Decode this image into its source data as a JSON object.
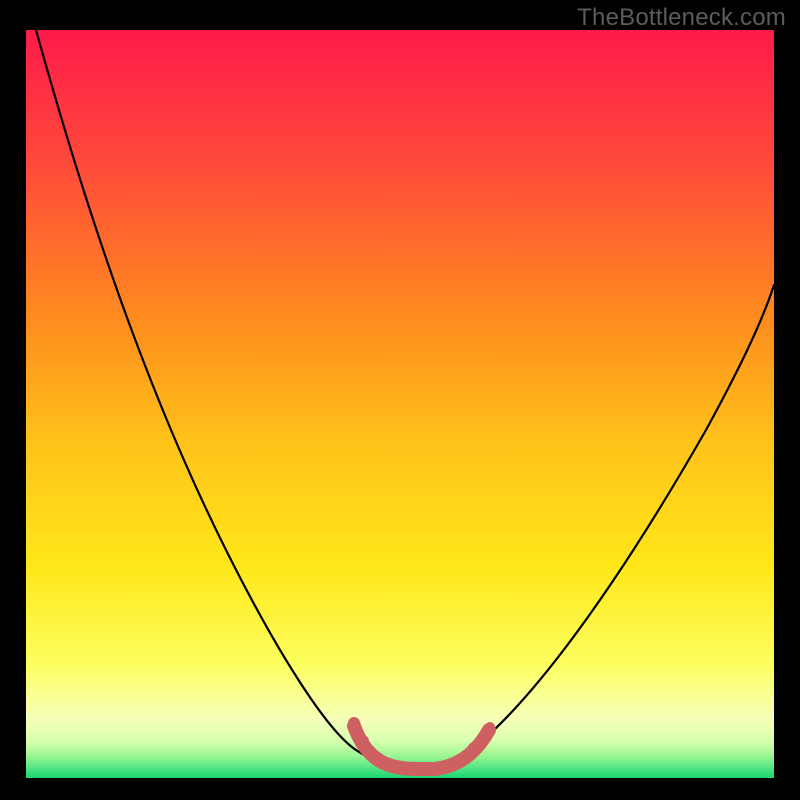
{
  "watermark": "TheBottleneck.com",
  "gradient_colors": {
    "top": "#ff1a4a",
    "mid1": "#ff6a2a",
    "mid2": "#ffc21a",
    "mid3": "#ffe81a",
    "pale": "#f8ffb8",
    "green_top": "#b7ff8c",
    "green_mid": "#4de87a",
    "green_bot": "#18d66e"
  },
  "chart_data": {
    "type": "line",
    "title": "",
    "xlabel": "",
    "ylabel": "",
    "xlim": [
      0,
      100
    ],
    "ylim": [
      0,
      100
    ],
    "grid": false,
    "series": [
      {
        "name": "bottleneck-curve",
        "x": [
          0,
          5,
          10,
          15,
          20,
          25,
          30,
          35,
          40,
          43,
          45,
          47,
          50,
          53,
          55,
          58,
          60,
          65,
          70,
          75,
          80,
          85,
          90,
          95,
          100
        ],
        "y": [
          100,
          92,
          84,
          76,
          67,
          57,
          46,
          33,
          18,
          10,
          5,
          2,
          1,
          1,
          2,
          4,
          7,
          14,
          23,
          31,
          39,
          47,
          54,
          61,
          67
        ]
      }
    ],
    "highlight": {
      "name": "optimal-band",
      "x": [
        43,
        45,
        47,
        50,
        53,
        55,
        58
      ],
      "y": [
        10,
        5,
        2,
        1,
        1,
        2,
        4
      ],
      "color": "#cf6062"
    }
  }
}
